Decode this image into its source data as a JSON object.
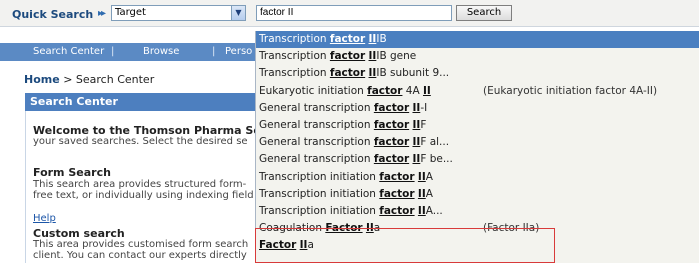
{
  "quick_search": {
    "label": "Quick Search",
    "arrow": "▸▸",
    "scope_value": "Target",
    "dropdown_arrow": "▼",
    "query_value": "factor II",
    "search_button": "Search"
  },
  "nav": {
    "items": [
      "Search Center",
      "Browse",
      "Perso"
    ],
    "separator": "|"
  },
  "breadcrumb": {
    "home": "Home",
    "separator": ">",
    "current": "Search Center"
  },
  "search_center": {
    "header": "Search Center",
    "welcome_title": "Welcome to the Thomson Pharma Sea",
    "welcome_text": "your saved searches. Select the desired se",
    "form_title": "Form Search",
    "form_text_1": "This search area provides structured form-",
    "form_text_2": "free text, or individually using indexing field",
    "help": "Help",
    "custom_title": "Custom search",
    "custom_text_1": "This area provides customised form search",
    "custom_text_2": "client. You can contact our experts directly"
  },
  "suggestions": [
    {
      "pre": "Transcription ",
      "term1": "factor",
      "mid": " ",
      "term2": "II",
      "post": "IB",
      "synonym": "",
      "selected": true
    },
    {
      "pre": "Transcription ",
      "term1": "factor",
      "mid": " ",
      "term2": "II",
      "post": "IB gene",
      "synonym": ""
    },
    {
      "pre": "Transcription ",
      "term1": "factor",
      "mid": " ",
      "term2": "II",
      "post": "IB subunit 9...",
      "synonym": ""
    },
    {
      "pre": "Eukaryotic initiation ",
      "term1": "factor",
      "mid": " 4A ",
      "term2": "II",
      "post": "",
      "synonym": "(Eukaryotic initiation factor 4A-II)"
    },
    {
      "pre": "General transcription ",
      "term1": "factor",
      "mid": " ",
      "term2": "II",
      "post": "-I",
      "synonym": ""
    },
    {
      "pre": "General transcription ",
      "term1": "factor",
      "mid": " ",
      "term2": "II",
      "post": "F",
      "synonym": ""
    },
    {
      "pre": "General transcription ",
      "term1": "factor",
      "mid": " ",
      "term2": "II",
      "post": "F al...",
      "synonym": ""
    },
    {
      "pre": "General transcription ",
      "term1": "factor",
      "mid": " ",
      "term2": "II",
      "post": "F be...",
      "synonym": ""
    },
    {
      "pre": "Transcription initiation ",
      "term1": "factor",
      "mid": " ",
      "term2": "II",
      "post": "A",
      "synonym": ""
    },
    {
      "pre": "Transcription initiation ",
      "term1": "factor",
      "mid": " ",
      "term2": "II",
      "post": "A",
      "synonym": ""
    },
    {
      "pre": "Transcription initiation ",
      "term1": "factor",
      "mid": " ",
      "term2": "II",
      "post": "A...",
      "synonym": ""
    },
    {
      "pre": "Coagulation ",
      "term1": "Factor",
      "mid": " ",
      "term2": "II",
      "post": "a",
      "synonym": "(Factor IIa)"
    },
    {
      "pre": "",
      "term1": "Factor",
      "mid": " ",
      "term2": "II",
      "post": "a",
      "synonym": ""
    }
  ],
  "colors": {
    "nav_blue": "#5b8ac4",
    "header_blue": "#4d7fbf",
    "selected_row": "#4a7fc0",
    "highlight_red": "#d83a3a"
  }
}
